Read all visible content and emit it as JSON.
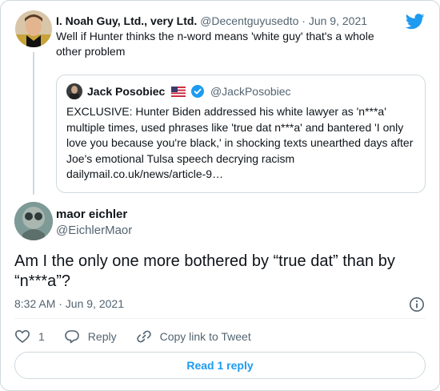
{
  "parent_tweet": {
    "display_name": "I. Noah Guy, Ltd., very Ltd.",
    "handle": "@Decentguyusedto",
    "date": "Jun 9, 2021",
    "text": "Well if Hunter thinks the n-word means 'white guy' that's a whole other problem"
  },
  "quoted_tweet": {
    "display_name": "Jack Posobiec",
    "handle": "@JackPosobiec",
    "text": "EXCLUSIVE: Hunter Biden addressed his white lawyer as 'n***a' multiple times, used phrases like 'true dat n***a' and bantered 'I only love you because you're black,' in shocking texts unearthed days after Joe's emotional Tulsa speech decrying racism",
    "link": "dailymail.co.uk/news/article-9…"
  },
  "reply_tweet": {
    "display_name": "maor eichler",
    "handle": "@EichlerMaor",
    "text": "Am I the only one more bothered by “true dat” than by “n***a”?",
    "timestamp": "8:32 AM · Jun 9, 2021"
  },
  "actions": {
    "like_count": "1",
    "reply_label": "Reply",
    "copy_link_label": "Copy link to Tweet"
  },
  "read_button_label": "Read 1 reply",
  "colors": {
    "accent": "#1d9bf0",
    "text": "#0f1419",
    "muted": "#536471",
    "border": "#cfd9de"
  },
  "icons": [
    "twitter-bird-icon",
    "us-flag-icon",
    "verified-badge-icon",
    "info-icon",
    "heart-icon",
    "reply-icon",
    "link-icon"
  ]
}
